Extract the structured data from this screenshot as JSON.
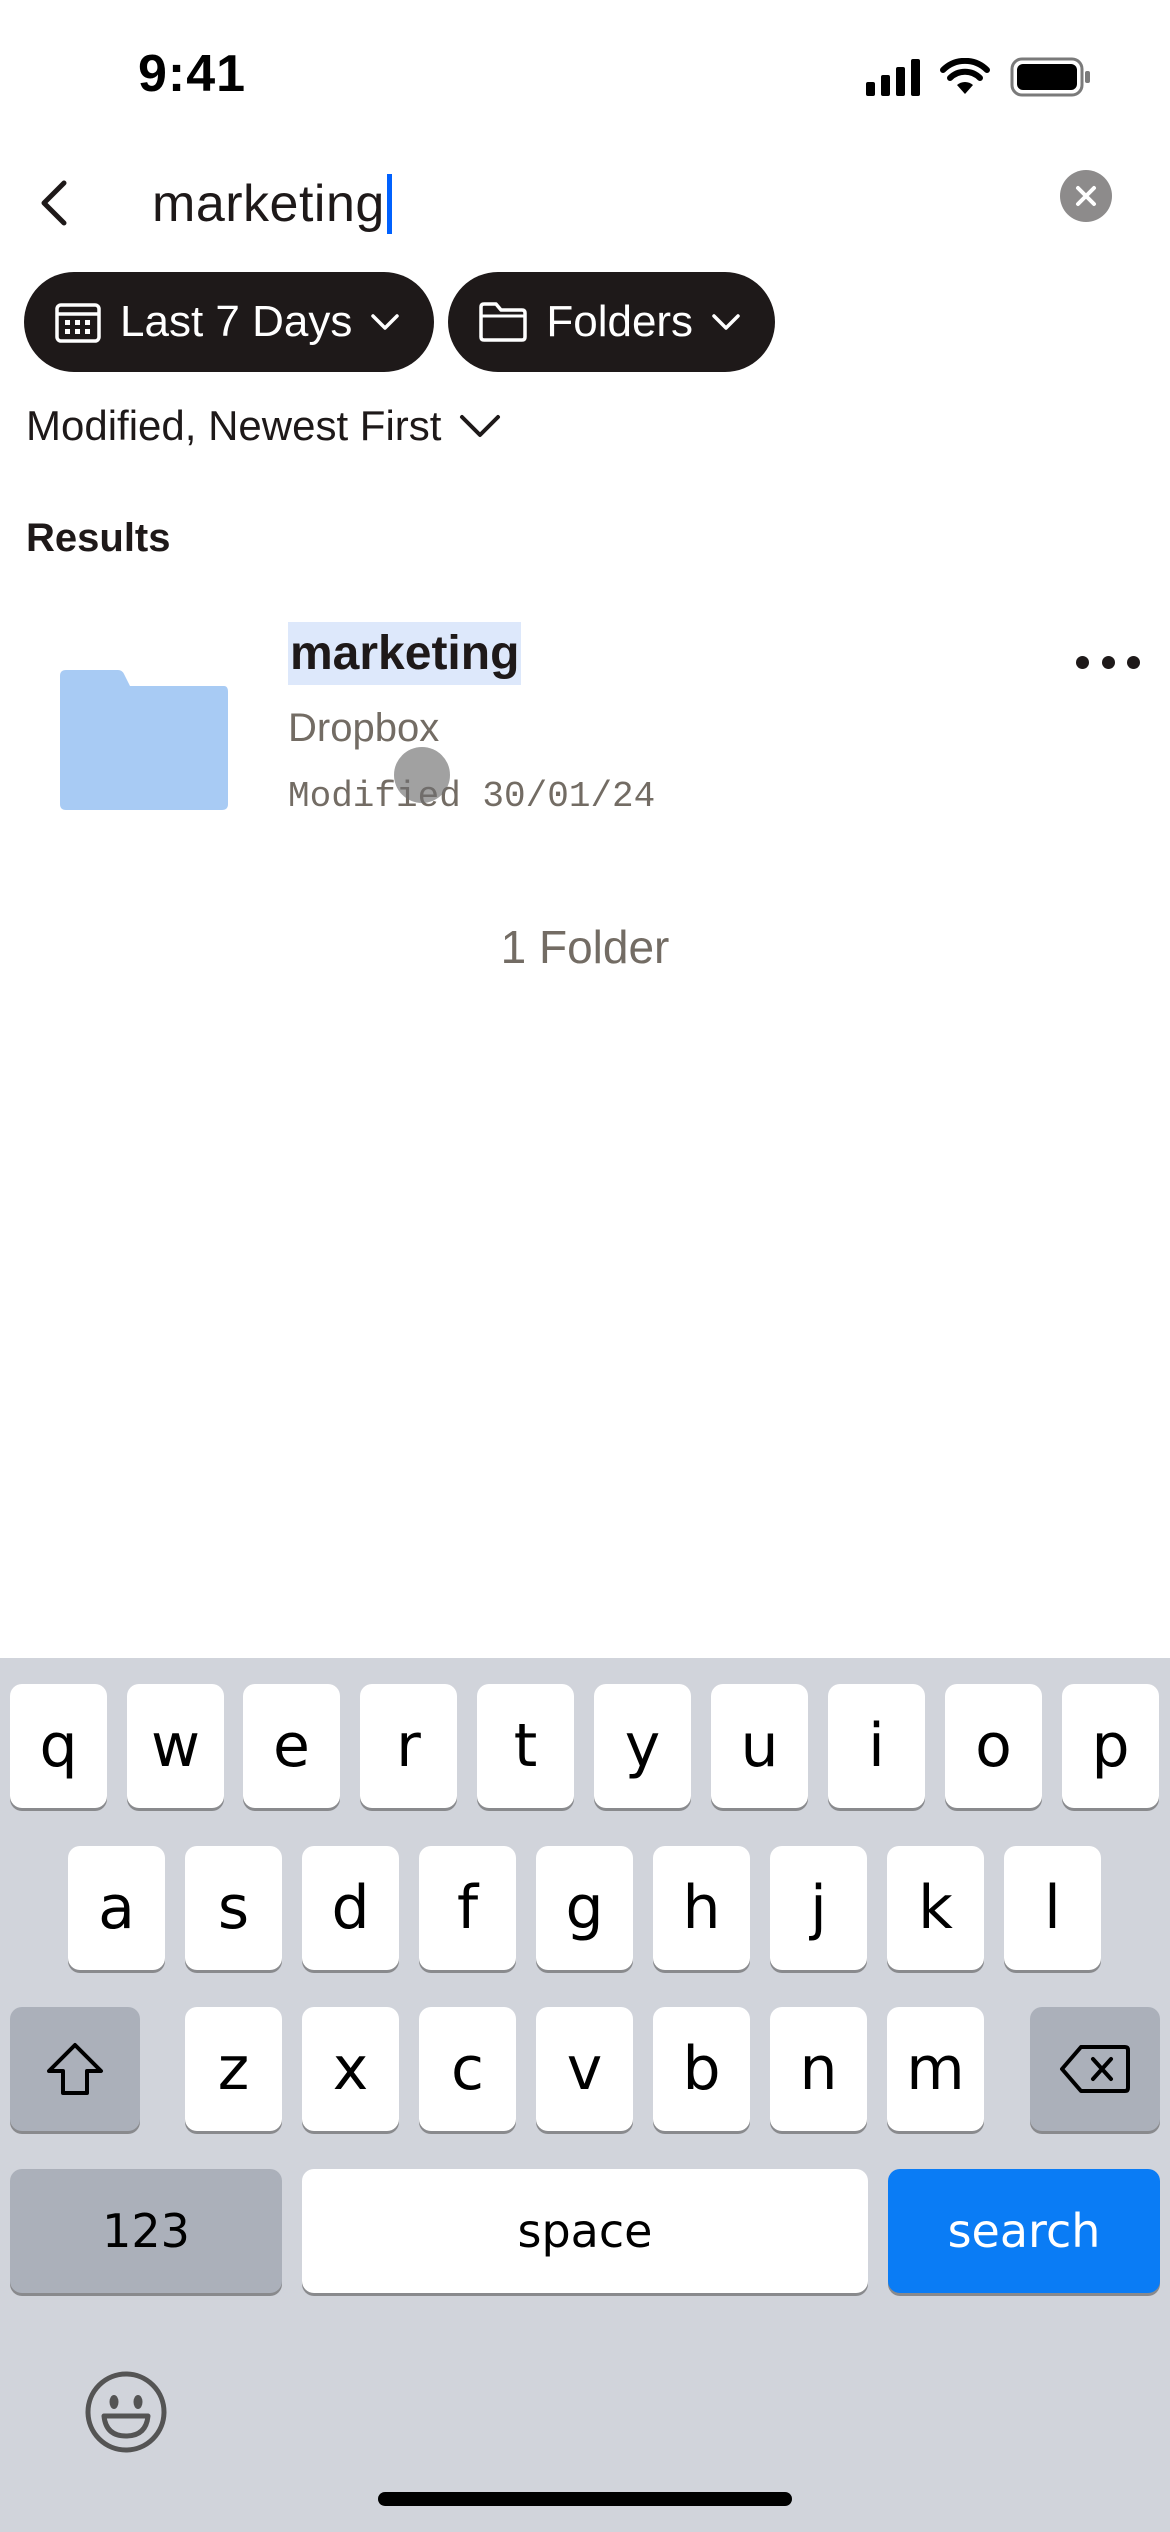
{
  "status_bar": {
    "time": "9:41"
  },
  "search": {
    "query": "marketing"
  },
  "filters": [
    {
      "label": "Last 7 Days",
      "icon": "calendar-icon"
    },
    {
      "label": "Folders",
      "icon": "folder-icon"
    }
  ],
  "sort": {
    "label": "Modified, Newest First"
  },
  "results": {
    "heading": "Results",
    "items": [
      {
        "name": "marketing",
        "location": "Dropbox",
        "modified": "Modified 30/01/24",
        "icon": "folder-icon"
      }
    ],
    "count_label": "1 Folder"
  },
  "keyboard": {
    "row1": [
      "q",
      "w",
      "e",
      "r",
      "t",
      "y",
      "u",
      "i",
      "o",
      "p"
    ],
    "row2": [
      "a",
      "s",
      "d",
      "f",
      "g",
      "h",
      "j",
      "k",
      "l"
    ],
    "row3": [
      "z",
      "x",
      "c",
      "v",
      "b",
      "n",
      "m"
    ],
    "numbers_label": "123",
    "space_label": "space",
    "search_label": "search"
  },
  "colors": {
    "accent": "#0061fe",
    "chip_bg": "#1e1919",
    "folder": "#a8cbf4",
    "search_key": "#0a7cf5",
    "keyboard_bg": "#d1d4db"
  }
}
